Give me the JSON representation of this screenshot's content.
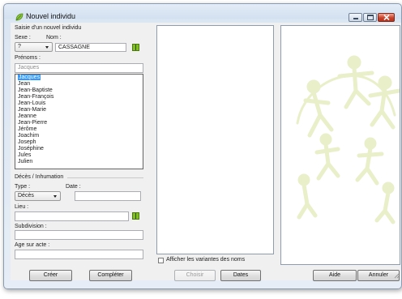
{
  "window": {
    "title": "Nouvel individu",
    "icon": "leaf-icon",
    "controls": [
      "minimize-icon",
      "maximize-icon",
      "close-icon"
    ]
  },
  "form": {
    "section_title": "Saisie d'un nouvel individu",
    "sexe_label": "Sexe :",
    "sexe_value": "?",
    "nom_label": "Nom :",
    "nom_value": "CASSAGNE",
    "prenoms_label": "Prénoms :",
    "prenoms_value": "Jacques",
    "suggestions": [
      "Jacques",
      "Jean",
      "Jean-Baptiste",
      "Jean-François",
      "Jean-Louis",
      "Jean-Marie",
      "Jeanne",
      "Jean-Pierre",
      "Jérôme",
      "Joachim",
      "Joseph",
      "Joséphine",
      "Jules",
      "Julien"
    ],
    "selected_suggestion": "Jacques"
  },
  "deces": {
    "section_title": "Décès / Inhumation",
    "type_label": "Type :",
    "type_value": "Décès",
    "date_label": "Date :",
    "date_value": "",
    "lieu_label": "Lieu :",
    "lieu_value": "",
    "subdivision_label": "Subdivision :",
    "subdivision_value": "",
    "age_label": "Age sur acte :",
    "age_value": ""
  },
  "middle": {
    "variants_checkbox_label": "Afficher les variantes des noms",
    "variants_checked": false
  },
  "buttons": {
    "creer": "Créer",
    "completer": "Compléter",
    "choisir": "Choisir",
    "dates": "Dates",
    "aide": "Aide",
    "annuler": "Annuler"
  },
  "colors": {
    "accent_green": "#7fbf1e",
    "selection_blue": "#3399ff",
    "watermark_green": "#e9efc8"
  }
}
